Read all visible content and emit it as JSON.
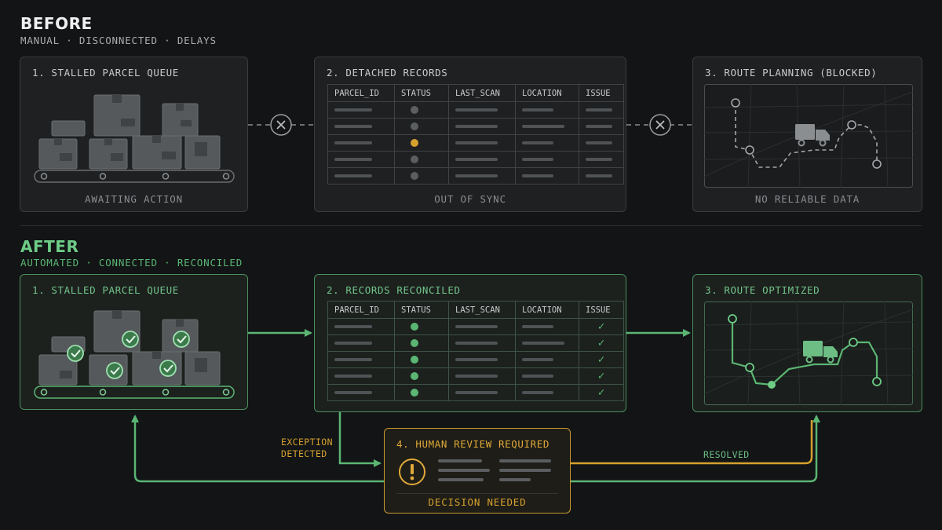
{
  "before": {
    "title": "BEFORE",
    "subtitle": "MANUAL · DISCONNECTED · DELAYS",
    "panel1": {
      "title": "1. STALLED PARCEL QUEUE",
      "caption": "AWAITING ACTION"
    },
    "panel2": {
      "title": "2. DETACHED RECORDS",
      "columns": [
        "PARCEL_ID",
        "STATUS",
        "LAST_SCAN",
        "LOCATION",
        "ISSUE"
      ],
      "row_status_colors": [
        "#5b5f62",
        "#5b5f62",
        "#d6a12e",
        "#5b5f62",
        "#5b5f62"
      ],
      "caption": "OUT OF SYNC"
    },
    "panel3": {
      "title": "3. ROUTE PLANNING (BLOCKED)",
      "caption": "NO RELIABLE DATA"
    }
  },
  "after": {
    "title": "AFTER",
    "subtitle": "AUTOMATED · CONNECTED · RECONCILED",
    "panel1": {
      "title": "1. STALLED PARCEL QUEUE"
    },
    "panel2": {
      "title": "2. RECORDS RECONCILED",
      "columns": [
        "PARCEL_ID",
        "STATUS",
        "LAST_SCAN",
        "LOCATION",
        "ISSUE"
      ],
      "row_status_colors": [
        "#5bb673",
        "#5bb673",
        "#5bb673",
        "#5bb673",
        "#5bb673"
      ]
    },
    "panel3": {
      "title": "3. ROUTE OPTIMIZED"
    },
    "review": {
      "title": "4. HUMAN REVIEW REQUIRED",
      "caption": "DECISION NEEDED"
    },
    "exception_label": [
      "EXCEPTION",
      "DETECTED"
    ],
    "resolved_label": "RESOLVED"
  },
  "colors": {
    "background": "#121416",
    "before_accent": "#c8cbce",
    "after_accent": "#5bb673",
    "warning_accent": "#d6a12e",
    "disconnect_icon": "x-circle-icon"
  }
}
